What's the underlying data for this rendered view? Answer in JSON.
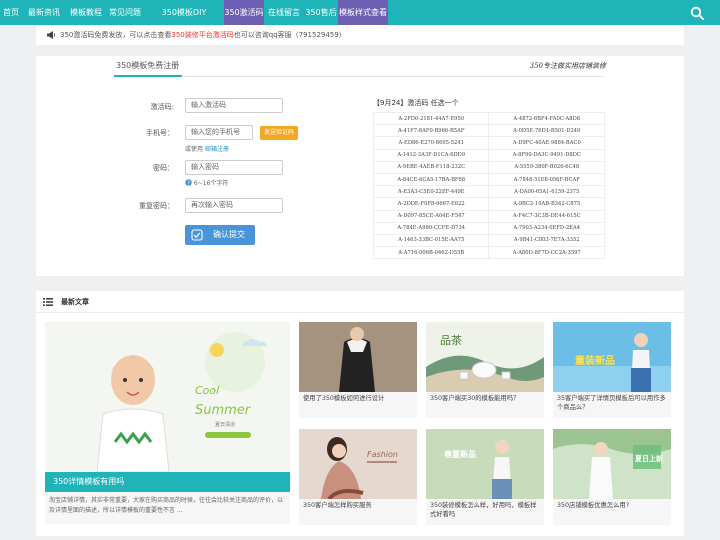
{
  "nav": {
    "items": [
      {
        "label": "首页",
        "active": false
      },
      {
        "label": "最新资讯",
        "active": false
      },
      {
        "label": "模板教程",
        "active": false
      },
      {
        "label": "常见问题",
        "active": false
      },
      {
        "label": "350模板DIY",
        "active": false
      },
      {
        "label": "350激活码",
        "active": true
      },
      {
        "label": "在线留言",
        "active": false
      },
      {
        "label": "350售后",
        "active": false
      },
      {
        "label": "模板样式查看",
        "active": true
      }
    ],
    "search_icon": "search-icon"
  },
  "notice": {
    "prefix": "350激活码免费发放，可以点击查看",
    "highlight": "350装修平台激活码",
    "suffix": "也可以咨询qq客服（791529459）"
  },
  "register": {
    "tab_title": "350模板免费注册",
    "slogan": "350专注做实用店铺装修",
    "activation": {
      "label": "激活码:",
      "placeholder": "输入激活码"
    },
    "phone": {
      "label": "手机号：",
      "placeholder": "输入您的手机号",
      "sms_button": "发送验证码",
      "hint_prefix": "或使用",
      "hint_link": "邮箱注册"
    },
    "password": {
      "label": "密码：",
      "placeholder": "输入密码",
      "hint": "6~16个字符"
    },
    "confirm": {
      "label": "重复密码：",
      "placeholder": "再次输入密码"
    },
    "submit": "确认提交"
  },
  "codes": {
    "heading": "【9月24】激活码 任选一个",
    "rows": [
      [
        "A-2FD0-2181-44A7-E950",
        "A-4872-6BF4-FA0C-A8D8"
      ],
      [
        "A-41F7-8AF0-B966-B5AF",
        "A-0D5E-76D1-B501-D249"
      ],
      [
        "A-ED86-E270-8695-5241",
        "A-D9FC-40AE-9884-BAC0"
      ],
      [
        "A-1412-3A3F-D1CA-6DD9",
        "A-8F90-DA3C-9491-D8DC"
      ],
      [
        "A-9EBE-4AEB-F118-232C",
        "A-5559-380F-B026-6C48"
      ],
      [
        "A-84CE-6CA5-17BA-BF68",
        "A-7848-51E8-056F-BCAF"
      ],
      [
        "A-E3A3-C5E0-22EF-449E",
        "A-DA00-65A1-6159-2375"
      ],
      [
        "A-2DDE-F0F8-6667-E622",
        "A-9BC2-10AB-B342-C875"
      ],
      [
        "A-D097-85CE-A04E-F547",
        "A-F4C7-3C3B-DE44-615C"
      ],
      [
        "A-784E-A980-CCFE-D734",
        "A-7903-A234-0EFD-2EA4"
      ],
      [
        "A-1463-33BC-015E-AA75",
        "A-9B41-C803-7E7A-3352"
      ],
      [
        "A-A716-006B-0462-D55B",
        "A-A80D-8F7D-CC2A-3597"
      ]
    ]
  },
  "articles": {
    "heading": "最新文章",
    "featured": {
      "title": "350详情模板有用吗",
      "desc": "淘宝店铺详情，其实非常重要，大家在购买商品的时候，往往会比较关注商品的评价，以及详情里面的描述，所以详情模板的重要性不言 ...",
      "banner_line1": "Cool",
      "banner_line2": "Summer",
      "banner_sub": "夏日清凉"
    },
    "cards": [
      {
        "title": "使用了350模板如何进行设计",
        "img": "jacket-model"
      },
      {
        "title": "350客户端买30的模板能用吗？",
        "img": "tea-set",
        "img_text": "品茶"
      },
      {
        "title": "35客户端买了详情页模板后可以用作多个商品么？",
        "img": "kids-banner",
        "img_text": "童装新品"
      },
      {
        "title": "350客户端怎样购买服务",
        "img": "fashion-woman",
        "img_text": "Fashion"
      },
      {
        "title": "350装修模板怎么样，好用吗，模板样式好看吗",
        "img": "spring-new",
        "img_text": "春夏新品"
      },
      {
        "title": "350店铺模板优惠怎么用?",
        "img": "summer-woman",
        "img_text": "夏日上新"
      }
    ]
  },
  "colors": {
    "primary": "#1fb5b8",
    "active_tab": "#6f5fb4",
    "sms_button": "#f5a623",
    "submit": "#4a95d9",
    "highlight": "#ee3333"
  }
}
